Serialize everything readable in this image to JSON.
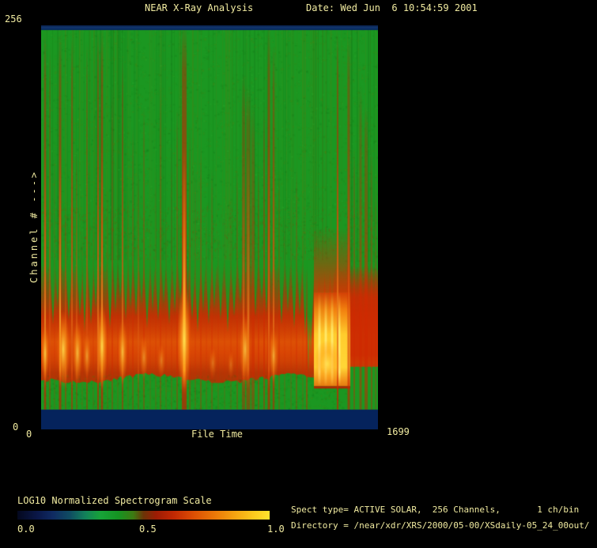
{
  "chart_data": {
    "type": "heatmap",
    "title": "NEAR X-Ray Analysis",
    "date_label": "Date: Wed Jun  6 10:54:59 2001",
    "xlabel": "File Time",
    "ylabel": "Channel # --->",
    "x_range": [
      0,
      1699
    ],
    "y_range": [
      0,
      256
    ],
    "x_tick_min": "0",
    "x_tick_max": "1699",
    "y_tick_min": "0",
    "y_tick_max": "256",
    "grid": false,
    "colorbar": {
      "label": "LOG10 Normalized Spectrogram Scale",
      "tick_labels": [
        "0.0",
        "0.5",
        "1.0"
      ],
      "stops": [
        "#04081e 0%",
        "#0a1748 8%",
        "#0f2a62 14%",
        "#0f4d62 21%",
        "#12825a 27%",
        "#17a338 33%",
        "#159422 40%",
        "#3d7a12 46%",
        "#6b3407 50%",
        "#9c1c04 55%",
        "#c22803 62%",
        "#dd4f04 70%",
        "#ec7c08 79%",
        "#f5a812 87%",
        "#fccb1e 94%",
        "#ffe42e 100%"
      ]
    },
    "info_line1": "Spect type= ACTIVE SOLAR,  256 Channels,       1 ch/bin",
    "info_line2": "Directory = /near/xdr/XRS/2000/05-00/XSdaily-05_24_00out/",
    "spectrogram": {
      "seed": 20010606,
      "palette": {
        "green": "#1b9721",
        "greenDark": "#137015",
        "greenLight": "#2fae2f",
        "olive": "#5d7c10",
        "navy": "#05235c",
        "navyLight": "#12386e",
        "text": "#f0eaa0"
      },
      "band": {
        "top": 0.585,
        "bot": 0.885
      },
      "wave": {
        "base": 0.875,
        "amp": 5,
        "period": 29
      },
      "stubEnd": 0.951,
      "navyTop": 6,
      "navyBottom": 25,
      "streaks": [
        [
          5,
          2.5,
          0.02,
          0.95,
          0.75
        ],
        [
          11,
          1.5,
          0.05,
          0.7,
          0.3
        ],
        [
          17,
          1,
          0.3,
          0.4,
          0
        ],
        [
          24,
          3,
          0.02,
          0.9,
          0.85
        ],
        [
          31,
          2,
          0.45,
          0.5,
          0.35
        ],
        [
          39,
          2,
          0.03,
          0.8,
          0.5
        ],
        [
          45,
          1.5,
          0.3,
          0.6,
          0.4
        ],
        [
          52,
          1,
          0.5,
          0.35,
          0
        ],
        [
          58,
          1.5,
          0.04,
          0.75,
          0.3
        ],
        [
          66,
          1,
          0.45,
          0.4,
          0
        ],
        [
          72,
          2,
          0.01,
          0.85,
          0.7
        ],
        [
          77,
          2.5,
          0.01,
          0.95,
          0.85
        ],
        [
          84,
          1,
          0.4,
          0.5,
          0
        ],
        [
          90,
          1.5,
          0.15,
          0.6,
          0
        ],
        [
          97,
          1,
          0.5,
          0.4,
          0
        ],
        [
          103,
          2,
          0.08,
          0.7,
          0.6
        ],
        [
          110,
          1,
          0.4,
          0.45,
          0
        ],
        [
          116,
          1.5,
          0.25,
          0.55,
          0
        ],
        [
          123,
          1.5,
          0.35,
          0.5,
          0.3
        ],
        [
          130,
          1.5,
          0.2,
          0.6,
          0
        ],
        [
          138,
          1,
          0.5,
          0.35,
          0
        ],
        [
          145,
          1,
          0.35,
          0.45,
          0
        ],
        [
          151,
          1.5,
          0.15,
          0.55,
          0
        ],
        [
          158,
          1,
          0.45,
          0.4,
          0
        ],
        [
          165,
          1,
          0.3,
          0.5,
          0
        ],
        [
          172,
          1.5,
          0.2,
          0.6,
          0
        ],
        [
          181,
          6,
          0,
          1,
          1
        ],
        [
          188,
          1.5,
          0.25,
          0.6,
          0
        ],
        [
          195,
          1,
          0.35,
          0.5,
          0
        ],
        [
          202,
          1.5,
          0.3,
          0.55,
          0
        ],
        [
          209,
          1,
          0.45,
          0.45,
          0
        ],
        [
          216,
          1.5,
          0.35,
          0.5,
          0
        ],
        [
          224,
          1,
          0.5,
          0.4,
          0
        ],
        [
          232,
          1,
          0.45,
          0.35,
          0
        ],
        [
          240,
          1,
          0.4,
          0.45,
          0
        ],
        [
          248,
          1.5,
          0.35,
          0.5,
          0
        ],
        [
          256,
          4,
          0.12,
          0.6,
          0.3
        ],
        [
          262,
          5,
          0.15,
          0.65,
          0.4
        ],
        [
          268,
          4,
          0.2,
          0.55,
          0
        ],
        [
          275,
          2,
          0.35,
          0.5,
          0
        ],
        [
          282,
          2,
          0.2,
          0.6,
          0
        ],
        [
          288,
          3,
          0.01,
          0.9,
          0.4
        ],
        [
          294,
          2.5,
          0.05,
          0.8,
          0.5
        ],
        [
          301,
          1.5,
          0.35,
          0.5,
          0
        ],
        [
          308,
          1,
          0.45,
          0.4,
          0
        ],
        [
          316,
          1,
          0.4,
          0.45,
          0
        ],
        [
          323,
          1.5,
          0.35,
          0.5,
          0
        ],
        [
          331,
          1,
          0.5,
          0.4,
          0
        ],
        [
          336,
          2,
          0.6,
          0.55,
          0
        ],
        [
          375,
          2,
          0.02,
          0.95,
          0.9
        ],
        [
          389,
          3,
          0.03,
          0.8,
          0.3
        ],
        [
          396,
          2,
          0.3,
          0.5,
          0
        ],
        [
          404,
          3,
          0.15,
          0.6,
          0
        ],
        [
          411,
          4,
          0.2,
          0.65,
          0
        ],
        [
          418,
          2,
          0.3,
          0.5,
          0
        ],
        [
          423,
          1.5,
          0.4,
          0.4,
          0
        ]
      ],
      "wedges": [
        [
          15,
          4,
          0.74
        ],
        [
          21,
          3,
          0.7
        ],
        [
          35,
          4,
          0.73
        ],
        [
          49,
          4,
          0.72
        ],
        [
          55,
          3,
          0.76
        ],
        [
          63,
          4,
          0.74
        ],
        [
          69,
          3,
          0.7
        ],
        [
          87,
          4,
          0.75
        ],
        [
          94,
          3,
          0.71
        ],
        [
          100,
          3,
          0.68
        ],
        [
          107,
          3,
          0.73
        ],
        [
          113,
          3,
          0.7
        ],
        [
          120,
          3,
          0.72
        ],
        [
          127,
          3,
          0.69
        ],
        [
          134,
          4,
          0.75
        ],
        [
          141,
          3,
          0.71
        ],
        [
          148,
          4,
          0.73
        ],
        [
          155,
          3,
          0.69
        ],
        [
          162,
          4,
          0.74
        ],
        [
          169,
          3,
          0.71
        ],
        [
          176,
          3,
          0.68
        ],
        [
          191,
          4,
          0.73
        ],
        [
          198,
          4,
          0.76
        ],
        [
          205,
          3,
          0.71
        ],
        [
          212,
          4,
          0.74
        ],
        [
          219,
          3,
          0.7
        ],
        [
          227,
          4,
          0.73
        ],
        [
          236,
          4,
          0.76
        ],
        [
          244,
          4,
          0.72
        ],
        [
          252,
          3,
          0.69
        ],
        [
          271,
          3,
          0.72
        ],
        [
          279,
          3,
          0.68
        ],
        [
          285,
          3,
          0.71
        ],
        [
          304,
          4,
          0.74
        ],
        [
          312,
          3,
          0.71
        ],
        [
          320,
          4,
          0.75
        ],
        [
          327,
          3,
          0.72
        ],
        [
          334,
          4,
          0.77
        ],
        [
          338,
          4,
          0.86
        ],
        [
          341,
          5,
          0.82
        ],
        [
          348,
          4,
          0.79
        ],
        [
          355,
          4,
          0.81
        ],
        [
          362,
          4,
          0.78
        ],
        [
          368,
          3,
          0.74
        ]
      ],
      "hotspots": [
        [
          5,
          415,
          5,
          36,
          0.8
        ],
        [
          28,
          410,
          8,
          50,
          0.9
        ],
        [
          46,
          414,
          6,
          40,
          0.75
        ],
        [
          58,
          418,
          5,
          28,
          0.55
        ],
        [
          77,
          406,
          7,
          55,
          0.95
        ],
        [
          103,
          413,
          6,
          42,
          0.75
        ],
        [
          130,
          420,
          5,
          28,
          0.5
        ],
        [
          152,
          424,
          5,
          22,
          0.4
        ],
        [
          181,
          398,
          9,
          70,
          1
        ],
        [
          217,
          427,
          5,
          20,
          0.35
        ],
        [
          240,
          429,
          4,
          18,
          0.3
        ],
        [
          258,
          410,
          7,
          45,
          0.75
        ],
        [
          294,
          418,
          6,
          34,
          0.6
        ],
        [
          362,
          428,
          18,
          30,
          0.85
        ]
      ],
      "block": {
        "x1": 345,
        "x2": 391,
        "top": 0.66,
        "bot": 0.893,
        "cols": [
          352,
          360,
          368,
          377
        ]
      },
      "right_zone": {
        "x1": 391,
        "x2": 426,
        "top": 0.6,
        "bot": 0.845
      }
    }
  }
}
